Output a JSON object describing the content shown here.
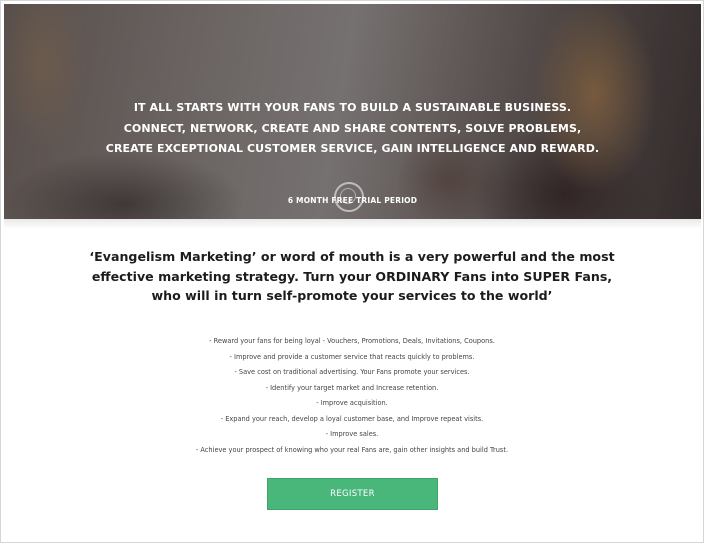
{
  "hero": {
    "lines": [
      "IT ALL STARTS WITH YOUR FANS TO BUILD A SUSTAINABLE BUSINESS.",
      "CONNECT, NETWORK, CREATE AND SHARE CONTENTS, SOLVE PROBLEMS,",
      "CREATE EXCEPTIONAL CUSTOMER SERVICE, GAIN INTELLIGENCE AND REWARD."
    ],
    "trial_label": "6 MONTH FREE TRIAL PERIOD"
  },
  "headline": {
    "lines": [
      "‘Evangelism Marketing’ or word of mouth is a very powerful and the most",
      "effective marketing strategy.  Turn your ORDINARY Fans into SUPER Fans,",
      "who will in turn self-promote your services to the world’"
    ]
  },
  "benefits": [
    "- Reward your fans for being loyal - Vouchers, Promotions, Deals, Invitations, Coupons.",
    "- Improve and provide a customer service that reacts quickly to problems.",
    "- Save cost on traditional advertising. Your Fans promote your services.",
    "- Identify your target market and Increase retention.",
    "- Improve acquisition.",
    "- Expand your reach, develop a loyal customer base, and Improve repeat visits.",
    "- Improve sales.",
    "- Achieve your prospect of knowing who your real Fans are, gain other insights and build Trust."
  ],
  "cta": {
    "register_label": "REGISTER",
    "color": "#49b77a"
  }
}
